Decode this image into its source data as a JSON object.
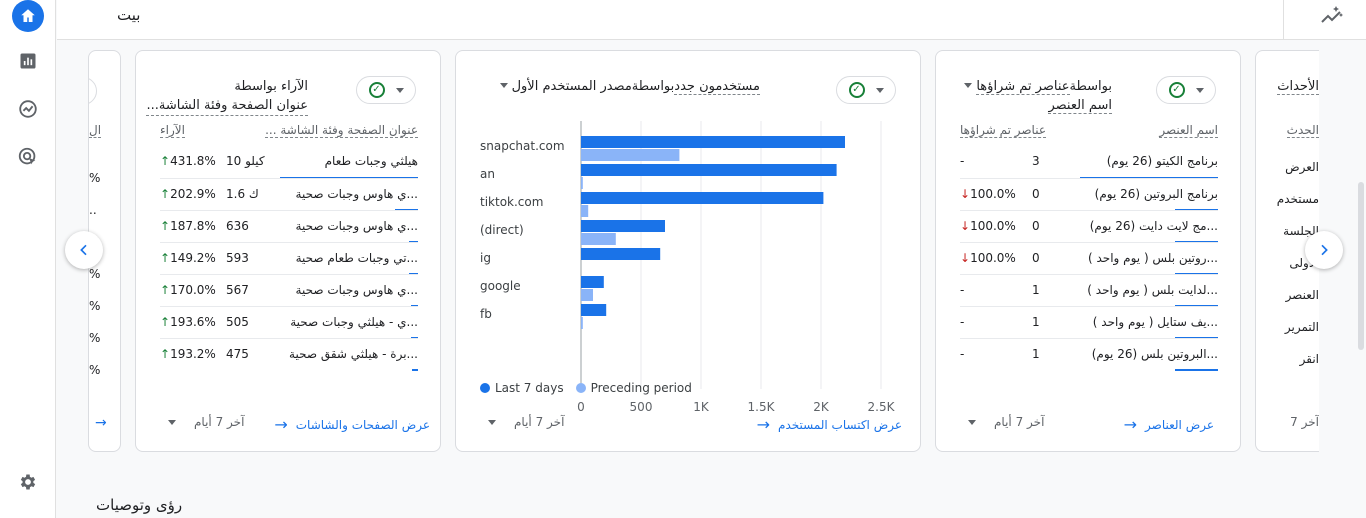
{
  "topbar": {
    "title": "بيت"
  },
  "bottom": {
    "title": "رؤى وتوصيات"
  },
  "colors": {
    "primary": "#1a73e8",
    "light": "#8ab4f8",
    "up": "#188038",
    "down": "#c5221f"
  },
  "partial_left": {
    "col": "ال",
    "values": [
      "%",
      "..",
      "%",
      "%",
      "%",
      "%",
      "%"
    ]
  },
  "partial_right": {
    "title": "الأحداث",
    "col": "الحدث",
    "values": [
      "العرض",
      "مستخدم",
      "الجلسة",
      "الأولى",
      "العنصر",
      "التمرير",
      "انقر"
    ],
    "foot": "آخر 7"
  },
  "card_pages": {
    "title_line1": "الآراء بواسطة",
    "title_line2": "عنوان الصفحة وفئة الشاشة...",
    "col_name": "عنوان الصفحة وفئة الشاشة ...",
    "col_value": "الآراء",
    "rows": [
      {
        "name": "هيلثي وجبات طعام",
        "value": "10 كيلو",
        "change": "431.8%",
        "bar": 0.95
      },
      {
        "name": "...ي هاوس وجبات صحية",
        "value": "1.6 ك",
        "change": "202.9%",
        "bar": 0.16
      },
      {
        "name": "...ي هاوس وجبات صحية",
        "value": "636",
        "change": "187.8%",
        "bar": 0.06
      },
      {
        "name": "...تي وجبات طعام صحية",
        "value": "593",
        "change": "149.2%",
        "bar": 0.06
      },
      {
        "name": "...ي هاوس وجبات صحية",
        "value": "567",
        "change": "170.0%",
        "bar": 0.05
      },
      {
        "name": "...ي - هيلثي وجبات صحية",
        "value": "505",
        "change": "193.6%",
        "bar": 0.05
      },
      {
        "name": "...برة - هيلثي شقق صحية",
        "value": "475",
        "change": "193.2%",
        "bar": 0.04
      }
    ],
    "period": "آخر 7 أيام",
    "link": "عرض الصفحات والشاشات"
  },
  "card_acq": {
    "title_a": "مستخدمون جدد",
    "title_b": "بواسطة",
    "title_c": "مصدر المستخدم الأول",
    "period": "آخر 7 أيام",
    "link": "عرض اكتساب المستخدم"
  },
  "chart_data": {
    "type": "bar",
    "orientation": "horizontal",
    "categories": [
      "snapchat.com",
      "an",
      "tiktok.com",
      "(direct)",
      "ig",
      "google",
      "fb"
    ],
    "series": [
      {
        "name": "Last 7 days",
        "values": [
          2200,
          2130,
          2020,
          700,
          660,
          190,
          210
        ]
      },
      {
        "name": "Preceding period",
        "values": [
          820,
          15,
          60,
          290,
          0,
          100,
          15
        ]
      }
    ],
    "xticks": [
      "0",
      "500",
      "1K",
      "1.5K",
      "2K",
      "2.5K"
    ],
    "xlim": [
      0,
      2500
    ],
    "grid": true,
    "legend": "bottom-left"
  },
  "card_items": {
    "title_a": "عناصر تم شراؤها",
    "title_b": "بواسطة",
    "title_c": "اسم العنصر",
    "col_name": "اسم العنصر",
    "col_value": "عناصر تم شراؤها",
    "rows": [
      {
        "name": "برنامج الكيتو (26 يوم)",
        "value": "3",
        "change": "-",
        "dir": "none",
        "bar": 0.95
      },
      {
        "name": "برنامج البروتين (26 يوم)",
        "value": "0",
        "change": "100.0%",
        "dir": "down",
        "bar": 0.3
      },
      {
        "name": "...مج لايت دايت (26 يوم)",
        "value": "0",
        "change": "100.0%",
        "dir": "down",
        "bar": 0.3
      },
      {
        "name": "...روتين بلس ( يوم واحد )",
        "value": "0",
        "change": "100.0%",
        "dir": "down",
        "bar": 0.3
      },
      {
        "name": "...لدايت بلس ( يوم واحد )",
        "value": "1",
        "change": "-",
        "dir": "none",
        "bar": 0.3
      },
      {
        "name": "...يف ستايل ( يوم واحد )",
        "value": "1",
        "change": "-",
        "dir": "none",
        "bar": 0.3
      },
      {
        "name": "...البروتين بلس (26 يوم)",
        "value": "1",
        "change": "-",
        "dir": "none",
        "bar": 0.3
      }
    ],
    "period": "آخر 7 أيام",
    "link": "عرض العناصر"
  }
}
